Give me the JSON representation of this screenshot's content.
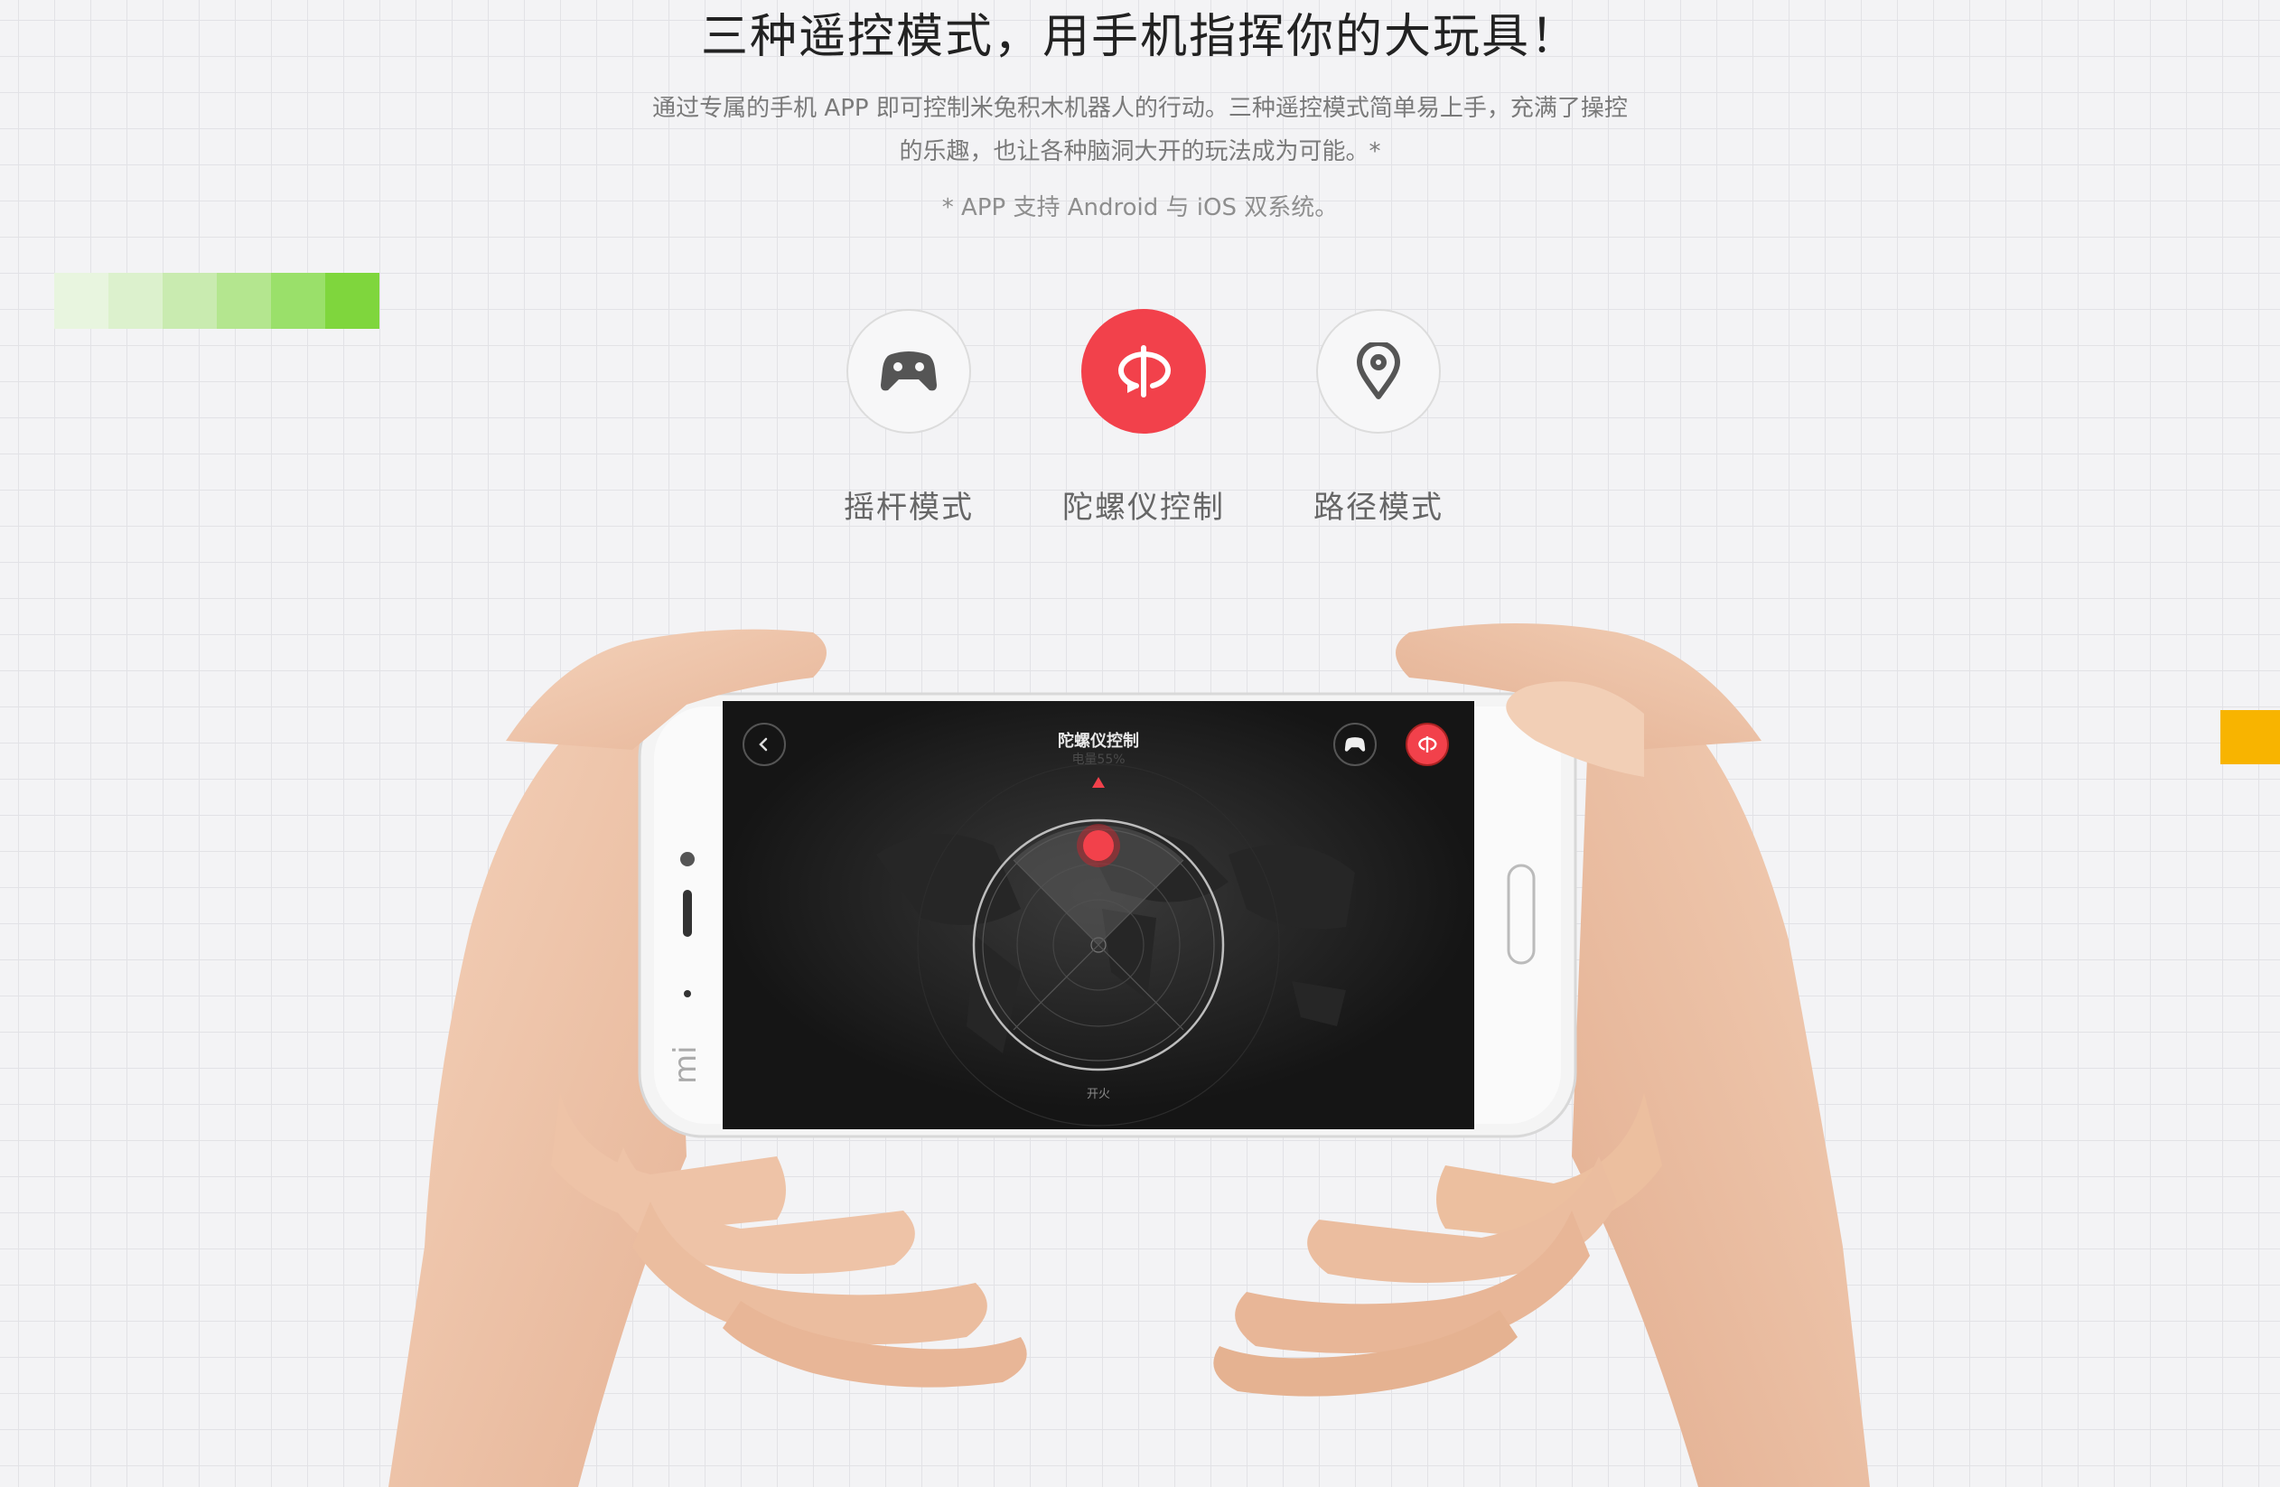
{
  "header": {
    "title": "三种遥控模式，用手机指挥你的大玩具！",
    "desc_line1": "通过专属的手机 APP 即可控制米兔积木机器人的行动。三种遥控模式简单易上手，充满了操控",
    "desc_line2": "的乐趣，也让各种脑洞大开的玩法成为可能。*",
    "note": "* APP 支持 Android 与 iOS 双系统。"
  },
  "modes": [
    {
      "label": "摇杆模式",
      "icon": "gamepad-icon",
      "active": false
    },
    {
      "label": "陀螺仪控制",
      "icon": "gyroscope-rotate-icon",
      "active": true
    },
    {
      "label": "路径模式",
      "icon": "map-pin-icon",
      "active": false
    }
  ],
  "phone_screen": {
    "title": "陀螺仪控制",
    "subtitle": "电量55%",
    "fire_label": "开火",
    "back_icon": "chevron-left-icon",
    "joystick_mode_icon": "gamepad-icon",
    "gyro_mode_icon": "gyroscope-rotate-icon"
  },
  "colors": {
    "accent_red": "#f2414b",
    "green_strip": [
      "#e8f5df",
      "#dcf1cd",
      "#c9ebb0",
      "#b4e68f",
      "#9ae06a",
      "#7fd63d"
    ],
    "yellow_block": "#f8b400"
  }
}
